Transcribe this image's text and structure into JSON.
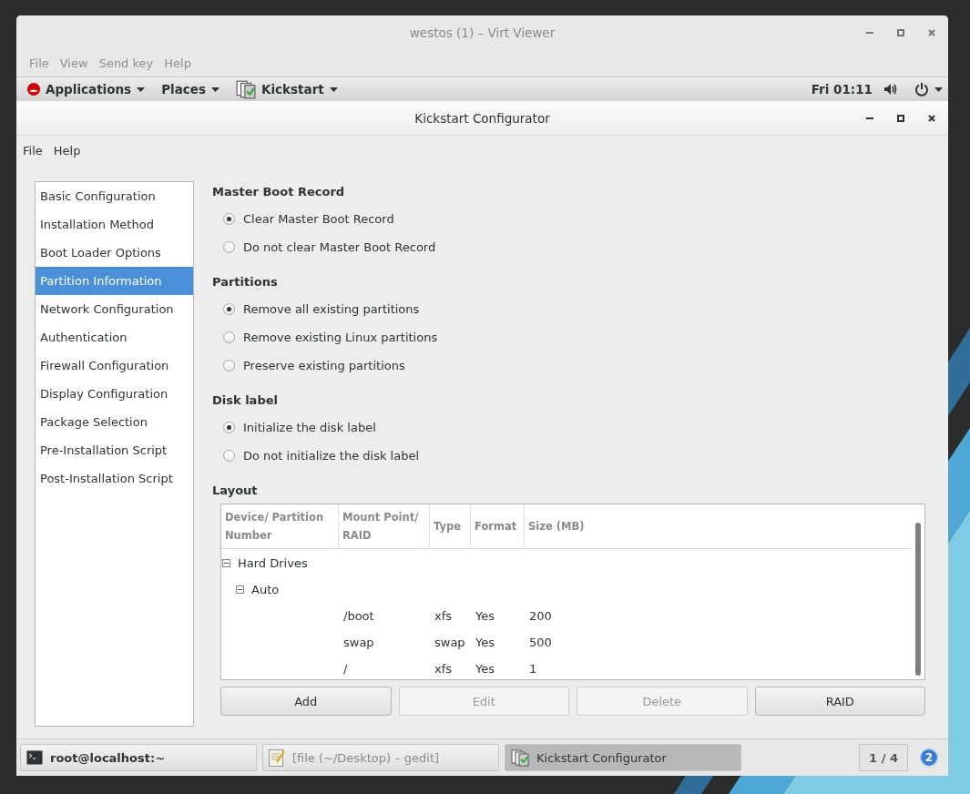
{
  "viewer_window": {
    "title": "westos (1) – Virt Viewer",
    "menu": [
      "File",
      "View",
      "Send key",
      "Help"
    ]
  },
  "top_bar": {
    "applications": "Applications",
    "places": "Places",
    "app_menu": "Kickstart",
    "clock": "Fri 01:11"
  },
  "app_window": {
    "title": "Kickstart Configurator",
    "menu": [
      "File",
      "Help"
    ]
  },
  "sidebar": {
    "items": [
      {
        "label": "Basic Configuration",
        "selected": false
      },
      {
        "label": "Installation Method",
        "selected": false
      },
      {
        "label": "Boot Loader Options",
        "selected": false
      },
      {
        "label": "Partition Information",
        "selected": true
      },
      {
        "label": "Network Configuration",
        "selected": false
      },
      {
        "label": "Authentication",
        "selected": false
      },
      {
        "label": "Firewall Configuration",
        "selected": false
      },
      {
        "label": "Display Configuration",
        "selected": false
      },
      {
        "label": "Package Selection",
        "selected": false
      },
      {
        "label": "Pre-Installation Script",
        "selected": false
      },
      {
        "label": "Post-Installation Script",
        "selected": false
      }
    ]
  },
  "sections": [
    {
      "heading": "Master Boot Record",
      "options": [
        {
          "label": "Clear Master Boot Record",
          "selected": true
        },
        {
          "label": "Do not clear Master Boot Record",
          "selected": false
        }
      ]
    },
    {
      "heading": "Partitions",
      "options": [
        {
          "label": "Remove all existing partitions",
          "selected": true
        },
        {
          "label": "Remove existing Linux partitions",
          "selected": false
        },
        {
          "label": "Preserve existing partitions",
          "selected": false
        }
      ]
    },
    {
      "heading": "Disk label",
      "options": [
        {
          "label": "Initialize the disk label",
          "selected": true
        },
        {
          "label": "Do not initialize the disk label",
          "selected": false
        }
      ]
    }
  ],
  "layout": {
    "heading": "Layout",
    "columns": [
      "Device/ Partition Number",
      "Mount Point/ RAID",
      "Type",
      "Format",
      "Size (MB)"
    ],
    "tree": [
      {
        "label": "Hard Drives",
        "expanded": true,
        "children": [
          {
            "label": "Auto",
            "expanded": true,
            "children": [
              {
                "mount": "/boot",
                "type": "xfs",
                "format": "Yes",
                "size": "200"
              },
              {
                "mount": "swap",
                "type": "swap",
                "format": "Yes",
                "size": "500"
              },
              {
                "mount": "/",
                "type": "xfs",
                "format": "Yes",
                "size": "1"
              }
            ]
          }
        ]
      }
    ],
    "buttons": [
      {
        "label": "Add",
        "disabled": false
      },
      {
        "label": "Edit",
        "disabled": true
      },
      {
        "label": "Delete",
        "disabled": true
      },
      {
        "label": "RAID",
        "disabled": false
      }
    ]
  },
  "taskbar": {
    "items": [
      {
        "label": "root@localhost:~",
        "kind": "terminal",
        "selected": false
      },
      {
        "label": "[file (~/Desktop) – gedit]",
        "kind": "editor",
        "selected": false
      },
      {
        "label": "Kickstart Configurator",
        "kind": "kickstart",
        "selected": true
      }
    ],
    "workspace": "1 / 4",
    "notifications": "2"
  }
}
